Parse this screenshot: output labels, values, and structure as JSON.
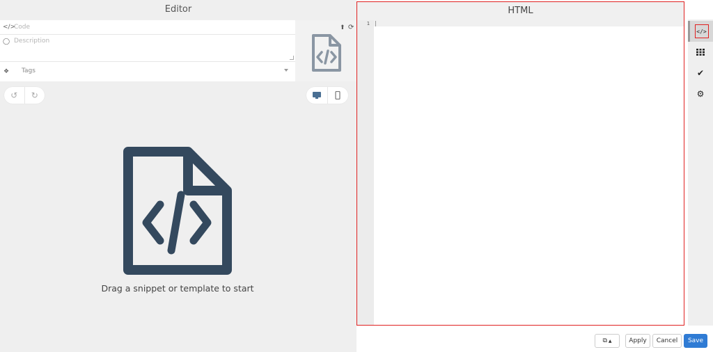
{
  "editor": {
    "title": "Editor",
    "code_placeholder": "Code",
    "description_placeholder": "Description",
    "tags_label": "Tags",
    "drag_hint": "Drag a snippet or template to start"
  },
  "html_pane": {
    "title": "HTML",
    "line_number": "1"
  },
  "footer": {
    "apply_label": "Apply",
    "cancel_label": "Cancel",
    "save_label": "Save"
  },
  "icons": {
    "code": "code-icon",
    "comment": "comment-icon",
    "tags": "tags-icon",
    "upload": "upload-icon",
    "refresh": "refresh-icon",
    "file_code": "file-code-icon",
    "undo": "undo-icon",
    "redo": "redo-icon",
    "desktop": "desktop-icon",
    "mobile": "mobile-icon",
    "grid": "grid-icon",
    "check": "check-icon",
    "gear": "gear-icon",
    "copy": "copy-icon"
  },
  "colors": {
    "accent": "#2f7bd4",
    "highlight_border": "#e02020",
    "icon_dark": "#34495e",
    "thumb_icon": "#8a96a3"
  }
}
